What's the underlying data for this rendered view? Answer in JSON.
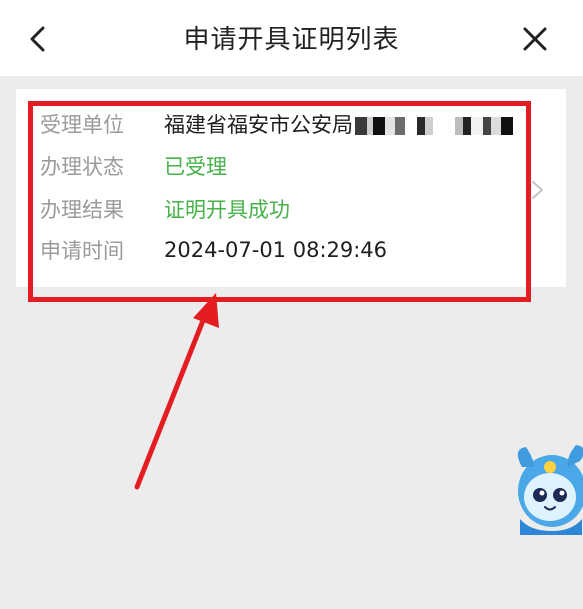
{
  "header": {
    "title": "申请开具证明列表",
    "back_icon": "chevron-left-icon",
    "close_icon": "close-icon"
  },
  "card": {
    "rows": [
      {
        "label": "受理单位",
        "value": "福建省福安市公安局"
      },
      {
        "label": "办理状态",
        "value": "已受理"
      },
      {
        "label": "办理结果",
        "value": "证明开具成功"
      },
      {
        "label": "申请时间",
        "value": "2024-07-01 08:29:46"
      }
    ],
    "chevron_icon": "chevron-right-icon"
  },
  "colors": {
    "status_green": "#47b249",
    "label_gray": "#9b9b9b",
    "annotation_red": "#e31d22",
    "page_bg": "#ececec"
  }
}
